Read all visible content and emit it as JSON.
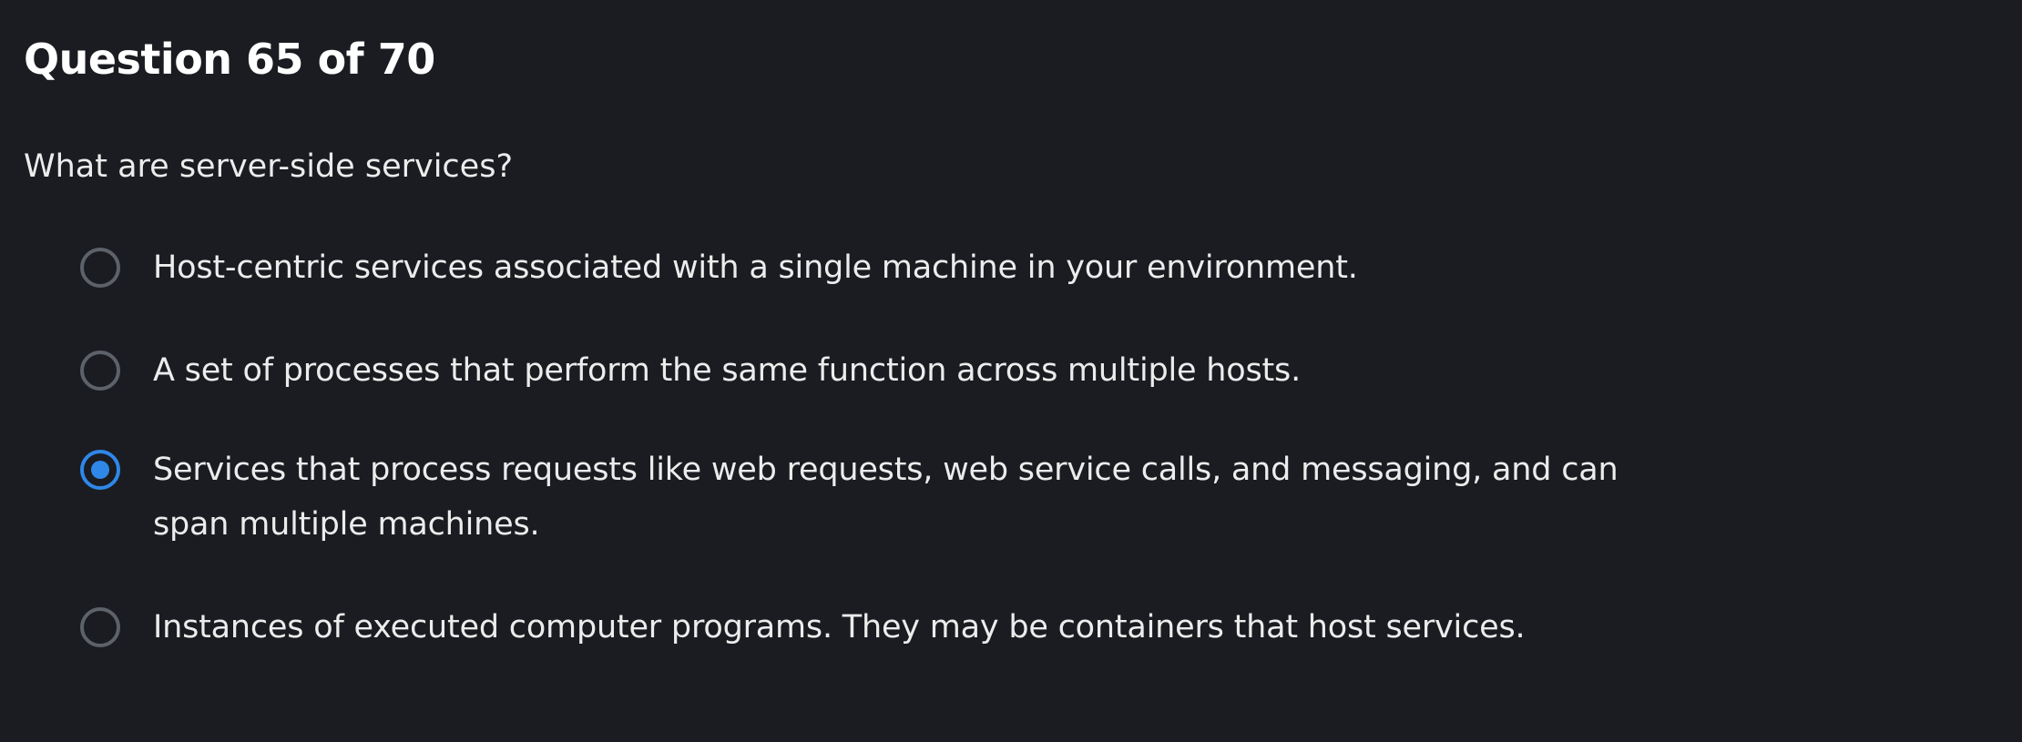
{
  "question": {
    "header": "Question 65 of 70",
    "prompt": "What are server-side services?",
    "selected_index": 2,
    "accent_color": "#2f87e8",
    "options": [
      {
        "label": "Host-centric services associated with a single machine in your environment.",
        "selected": false
      },
      {
        "label": "A set of processes that perform the same function across multiple hosts.",
        "selected": false
      },
      {
        "label": "Services that process requests like web requests, web service calls, and messaging, and can span multiple machines.",
        "selected": true
      },
      {
        "label": "Instances of executed computer programs. They may be containers that host services.",
        "selected": false
      }
    ]
  }
}
